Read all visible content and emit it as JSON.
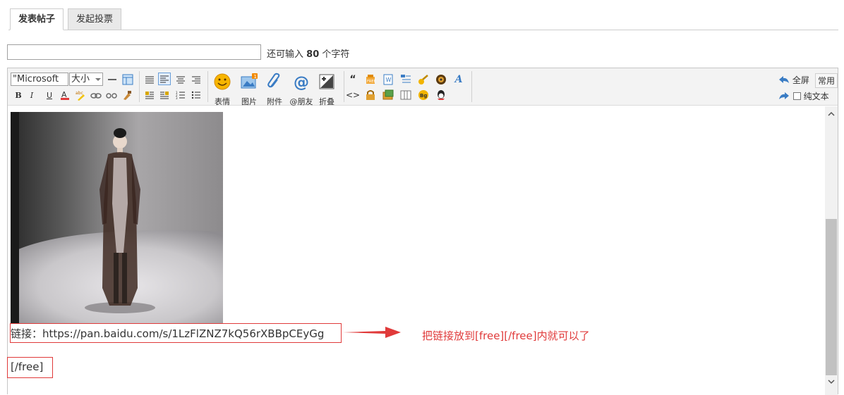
{
  "tabs": [
    {
      "label": "发表帖子",
      "active": true
    },
    {
      "label": "发起投票",
      "active": false
    }
  ],
  "subject": {
    "value": "",
    "counter_prefix": "还可输入",
    "counter_num": "80",
    "counter_suffix": "个字符"
  },
  "toolbar": {
    "font_value": "\"Microsoft",
    "size_value": "大小",
    "big_buttons": [
      "表情",
      "图片",
      "附件",
      "@朋友",
      "折叠"
    ],
    "fullscreen_label": "全屏",
    "common_label": "常用",
    "plain_text_label": "纯文本"
  },
  "content": {
    "link_line": "链接：https://pan.baidu.com/s/1LzFlZNZ7kQ56rXBBpCEyGg",
    "free_close": "[/free]"
  },
  "annotation": {
    "text": "把链接放到[free][/free]内就可以了",
    "color": "#e03a3a"
  },
  "icons": [
    "hr-icon",
    "table-icon",
    "align-left-icon",
    "align-center-icon",
    "align-right-icon",
    "bold-icon",
    "italic-icon",
    "underline-icon",
    "font-color-icon",
    "background-color-icon",
    "link-icon",
    "unlink-icon",
    "clear-format-icon",
    "float-left-icon",
    "float-right-icon",
    "ordered-list-icon",
    "unordered-list-icon",
    "emoticon-icon",
    "image-icon",
    "attachment-icon",
    "at-icon",
    "collapse-icon",
    "quote-icon",
    "code-icon",
    "free-icon",
    "hide-icon",
    "page-icon",
    "index-icon",
    "password-icon",
    "media-icon",
    "flash-icon",
    "font-style-icon",
    "background-icon",
    "qq-icon",
    "undo-icon",
    "redo-icon",
    "plain-text-checkbox"
  ]
}
